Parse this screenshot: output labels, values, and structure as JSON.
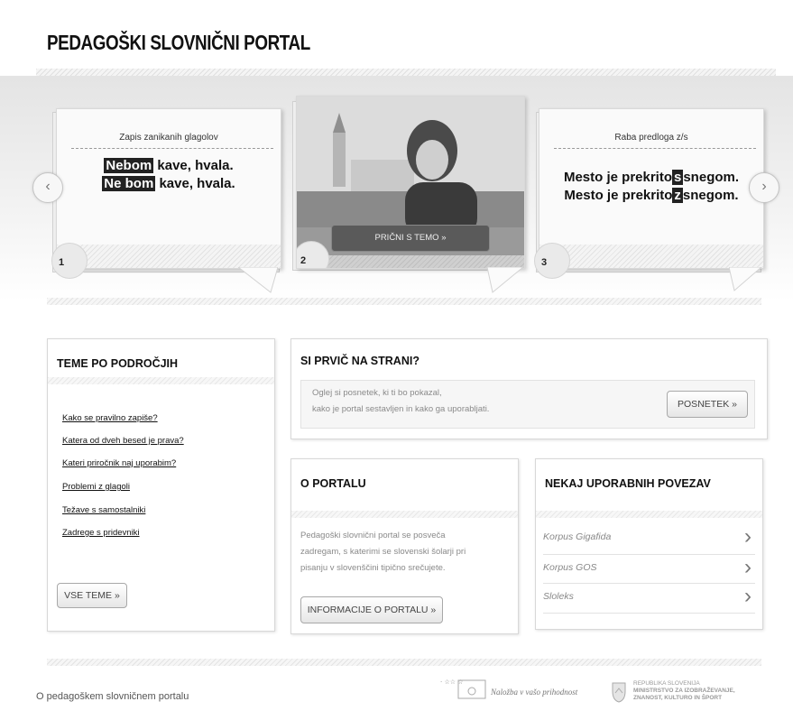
{
  "header": {
    "title": "PEDAGOŠKI SLOVNIČNI PORTAL"
  },
  "carousel": {
    "prev_icon": "chevron-left-icon",
    "next_icon": "chevron-right-icon",
    "prev_glyph": "‹",
    "next_glyph": "›",
    "slides": [
      {
        "number": "1",
        "title": "Zapis zanikanih glagolov",
        "line1_hl": "Nebom",
        "line1_rest": " kave, hvala.",
        "line2_hl": "Ne bom",
        "line2_rest": " kave, hvala."
      },
      {
        "number": "2",
        "button": "PRIČNI S TEMO »"
      },
      {
        "number": "3",
        "title": "Raba predloga z/s",
        "line1_pre": "Mesto je prekrito",
        "line1_hl": "s",
        "line1_rest": "snegom.",
        "line2_pre": "Mesto je prekrito",
        "line2_hl": "z",
        "line2_rest": "snegom."
      }
    ]
  },
  "topics": {
    "heading": "TEME PO PODROČJIH",
    "links": [
      "Kako se pravilno zapiše?",
      "Katera od dveh besed je prava?",
      "Kateri priročnik naj uporabim?",
      "Problemi z glagoli",
      "Težave s samostalniki",
      "Zadrege s pridevniki"
    ],
    "all_button": "VSE TEME »"
  },
  "first_time": {
    "heading": "SI PRVIČ NA STRANI?",
    "line1": "Oglej si posnetek, ki ti bo pokazal,",
    "line2": "kako je portal sestavljen in kako ga uporabljati.",
    "button": "POSNETEK »"
  },
  "about": {
    "heading": "O PORTALU",
    "line1": "Pedagoški slovnični portal se posveča",
    "line2": "zadregam, s katerimi se slovenski šolarji pri",
    "line3": "pisanju v slovenščini tipično srečujete.",
    "button": "INFORMACIJE O PORTALU »"
  },
  "useful_links": {
    "heading": "NEKAJ UPORABNIH POVEZAV",
    "items": [
      "Korpus Gigafida",
      "Korpus GOS",
      "Sloleks"
    ],
    "chevron_icon": "chevron-right-icon",
    "chevron_glyph": "›"
  },
  "footer": {
    "about_link": "O pedagoškem slovničnem portalu",
    "logo1_text": "Naložba v vašo prihodnost",
    "logo2_line1": "REPUBLIKA SLOVENIJA",
    "logo2_line2": "MINISTRSTVO ZA IZOBRAŽEVANJE,",
    "logo2_line3": "ZNANOST, KULTURO IN ŠPORT"
  }
}
